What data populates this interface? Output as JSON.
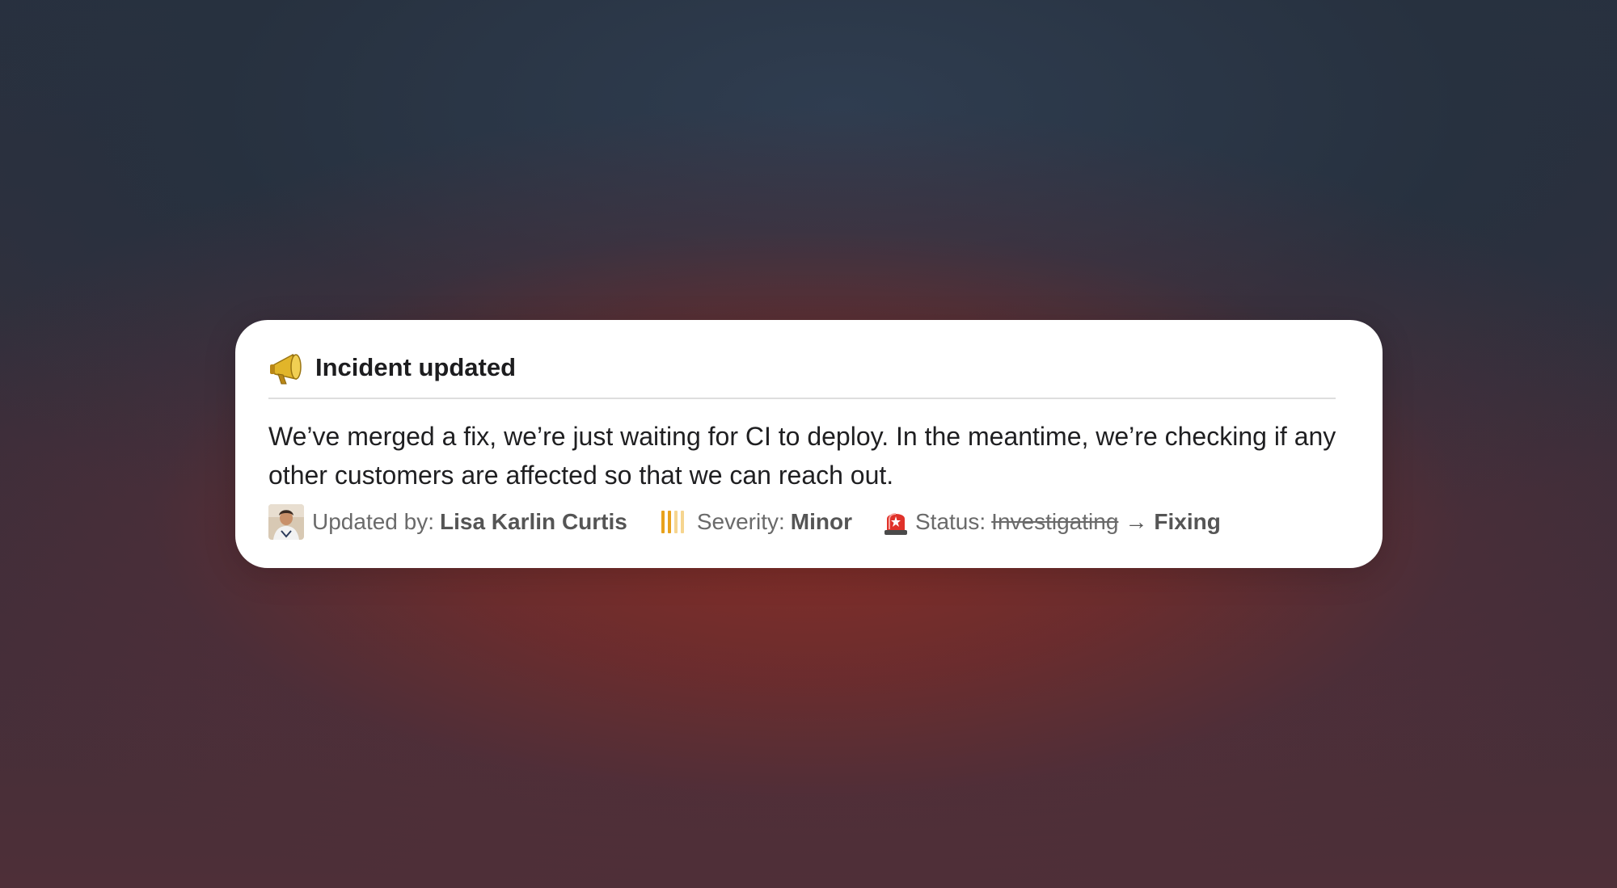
{
  "card": {
    "title": "Incident updated",
    "title_icon": "megaphone-icon",
    "message": "We’ve merged a fix, we’re just waiting for CI to deploy. In the meantime, we’re checking if any other customers are affected so that we can reach out.",
    "updated_by": {
      "label": "Updated by:",
      "name": "Lisa Karlin Curtis"
    },
    "severity": {
      "icon": "severity-bars-icon",
      "label": "Severity:",
      "value": "Minor",
      "color": "#e8a21c"
    },
    "status": {
      "icon": "siren-icon",
      "label": "Status:",
      "previous": "Investigating",
      "arrow": "→",
      "current": "Fixing"
    }
  },
  "colors": {
    "card_bg": "#ffffff",
    "text": "#1f1f21",
    "muted_text": "#6a6a6a",
    "accent_red": "#e0322a",
    "megaphone_gold": "#d9a520"
  }
}
